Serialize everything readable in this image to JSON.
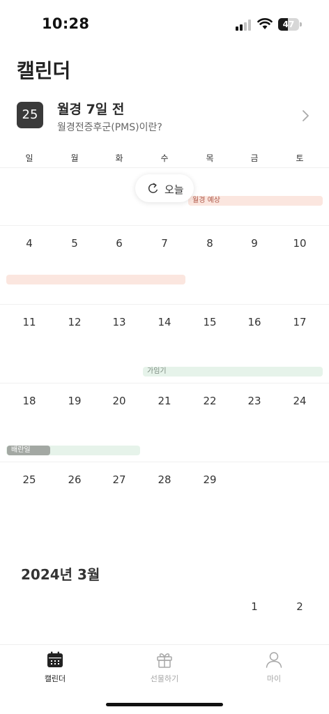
{
  "status_bar": {
    "time": "10:28",
    "battery": "47",
    "battery_level": 0.47
  },
  "header": {
    "title": "캘린더"
  },
  "period_card": {
    "day": "25",
    "title": "월경 7일 전",
    "subtitle": "월경전증후군(PMS)이란?"
  },
  "weekdays": [
    "일",
    "월",
    "화",
    "수",
    "목",
    "금",
    "토"
  ],
  "today_button": {
    "label": "오늘",
    "icon": "refresh-icon"
  },
  "weeks": [
    [
      "",
      "",
      "",
      "",
      "",
      "",
      ""
    ],
    [
      "4",
      "5",
      "6",
      "7",
      "8",
      "9",
      "10"
    ],
    [
      "11",
      "12",
      "13",
      "14",
      "15",
      "16",
      "17"
    ],
    [
      "18",
      "19",
      "20",
      "21",
      "22",
      "23",
      "24"
    ],
    [
      "25",
      "26",
      "27",
      "28",
      "29",
      "",
      ""
    ]
  ],
  "events": {
    "period_forecast": {
      "label": "월경 예상",
      "color": "#fbe6df",
      "text_color": "#b05a4a"
    },
    "fertile": {
      "label": "가임기",
      "color": "#e6f3ea",
      "text_color": "#7a8a7e"
    },
    "ovulation": {
      "label": "배란일",
      "color": "#a3a8a3",
      "text_color": "#ffffff"
    }
  },
  "next_month": {
    "title": "2024년 3월",
    "first_row": [
      "",
      "",
      "",
      "",
      "",
      "1",
      "2"
    ]
  },
  "tabbar": {
    "items": [
      {
        "label": "캘린더",
        "icon": "calendar-icon",
        "active": true
      },
      {
        "label": "선물하기",
        "icon": "gift-icon",
        "active": false
      },
      {
        "label": "마이",
        "icon": "person-icon",
        "active": false
      }
    ]
  },
  "colors": {
    "active": "#222222",
    "inactive": "#a7a7a7"
  }
}
